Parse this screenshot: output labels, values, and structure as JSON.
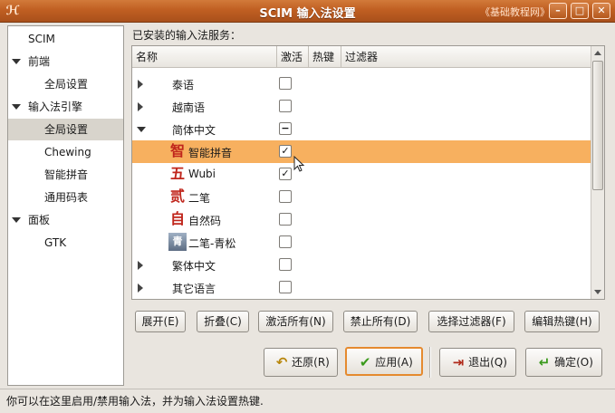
{
  "window": {
    "title": "SCIM 输入法设置",
    "watermark": "《基础教程网》",
    "app_icon": "scim-logo-icon",
    "controls": {
      "minimize": "–",
      "maximize": "□",
      "close": "✕"
    }
  },
  "sidebar": {
    "items": [
      {
        "label": "SCIM",
        "level": 0,
        "expander": "none"
      },
      {
        "label": "前端",
        "level": 0,
        "expander": "expanded"
      },
      {
        "label": "全局设置",
        "level": 1,
        "expander": "none"
      },
      {
        "label": "输入法引擎",
        "level": 0,
        "expander": "expanded"
      },
      {
        "label": "全局设置",
        "level": 1,
        "expander": "none",
        "selected": true
      },
      {
        "label": "Chewing",
        "level": 1,
        "expander": "none"
      },
      {
        "label": "智能拼音",
        "level": 1,
        "expander": "none"
      },
      {
        "label": "通用码表",
        "level": 1,
        "expander": "none"
      },
      {
        "label": "面板",
        "level": 0,
        "expander": "expanded"
      },
      {
        "label": "GTK",
        "level": 1,
        "expander": "none"
      }
    ]
  },
  "main": {
    "section_label": "已安装的输入法服务：",
    "columns": [
      "名称",
      "激活",
      "热键",
      "过滤器"
    ],
    "rows": [
      {
        "name": "泰语",
        "expander": "collapsed",
        "icon": "",
        "checkbox": "unchecked"
      },
      {
        "name": "越南语",
        "expander": "collapsed",
        "icon": "",
        "checkbox": "unchecked"
      },
      {
        "name": "简体中文",
        "expander": "expanded",
        "icon": "",
        "checkbox": "mixed"
      },
      {
        "name": "智能拼音",
        "expander": "none",
        "icon": "智",
        "checkbox": "checked",
        "selected": true
      },
      {
        "name": "Wubi",
        "expander": "none",
        "icon": "五",
        "checkbox": "checked"
      },
      {
        "name": "二笔",
        "expander": "none",
        "icon": "贰",
        "checkbox": "unchecked"
      },
      {
        "name": "自然码",
        "expander": "none",
        "icon": "自",
        "checkbox": "unchecked"
      },
      {
        "name": "二笔-青松",
        "expander": "none",
        "icon": "青",
        "checkbox": "unchecked"
      },
      {
        "name": "繁体中文",
        "expander": "collapsed",
        "icon": "",
        "checkbox": "unchecked"
      },
      {
        "name": "其它语言",
        "expander": "collapsed",
        "icon": "",
        "checkbox": "unchecked"
      }
    ],
    "action_buttons": [
      "展开(E)",
      "折叠(C)",
      "激活所有(N)",
      "禁止所有(D)",
      "选择过滤器(F)",
      "编辑热键(H)"
    ],
    "checkbox_glyphs": {
      "checked": "✓",
      "mixed": "−",
      "unchecked": ""
    }
  },
  "dialog_buttons": {
    "revert": {
      "label": "还原(R)",
      "icon": "revert-icon",
      "glyph": "↶"
    },
    "apply": {
      "label": "应用(A)",
      "icon": "checkmark-icon",
      "glyph": "✔"
    },
    "quit": {
      "label": "退出(Q)",
      "icon": "exit-door-icon",
      "glyph": "⇥"
    },
    "ok": {
      "label": "确定(O)",
      "icon": "enter-arrow-icon",
      "glyph": "↵"
    }
  },
  "statusbar": {
    "text": "你可以在这里启用/禁用输入法，并为输入法设置热键."
  },
  "colors": {
    "titlebar": "#c05f22",
    "selection_row": "#f7b05f",
    "focus_border": "#e58a2f",
    "im_icon_red": "#c0261c"
  }
}
